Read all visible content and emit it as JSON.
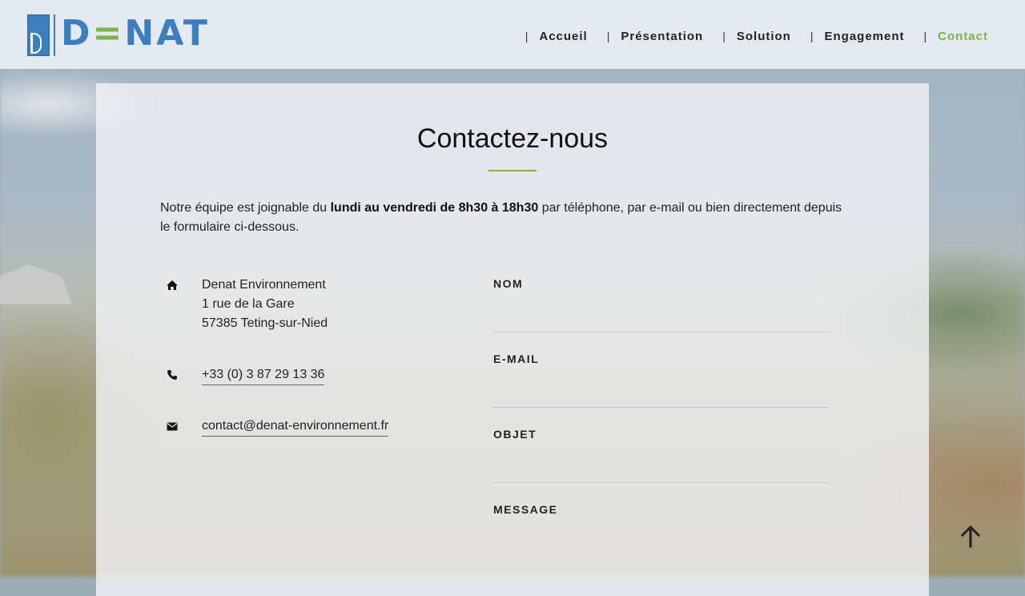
{
  "brand": {
    "name_d": "D",
    "name_e": "=",
    "name_rest": "NAT"
  },
  "nav": {
    "items": [
      {
        "label": "Accueil"
      },
      {
        "label": "Présentation"
      },
      {
        "label": "Solution"
      },
      {
        "label": "Engagement"
      },
      {
        "label": "Contact",
        "active": true
      }
    ],
    "separator": "|",
    "active_color": "#7ab547"
  },
  "contact": {
    "title": "Contactez-nous",
    "intro_before": "Notre équipe est joignable du ",
    "intro_bold": "lundi au vendredi de 8h30 à 18h30",
    "intro_after": " par téléphone, par e-mail ou bien directement depuis le formulaire ci-dessous.",
    "address": {
      "icon": "home-icon",
      "line1": "Denat Environnement",
      "line2": "1 rue de la Gare",
      "line3": "57385 Teting-sur-Nied"
    },
    "phone": {
      "icon": "phone-icon",
      "value": "+33 (0) 3 87 29 13 36"
    },
    "email": {
      "icon": "envelope-icon",
      "value": "contact@denat-environnement.fr"
    }
  },
  "form": {
    "fields": [
      {
        "label": "NOM",
        "value": ""
      },
      {
        "label": "E-MAIL",
        "value": ""
      },
      {
        "label": "OBJET",
        "value": ""
      },
      {
        "label": "MESSAGE",
        "value": ""
      }
    ]
  },
  "scroll_top": {
    "icon": "arrow-up-icon"
  },
  "colors": {
    "brand_blue": "#3b7fc0",
    "brand_green": "#7ab547"
  }
}
